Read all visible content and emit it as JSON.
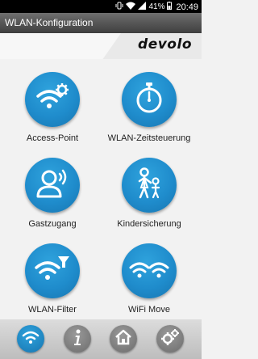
{
  "status_bar": {
    "battery": "41%",
    "time": "20:49",
    "icons": [
      "vibrate-icon",
      "wifi-signal-icon",
      "cell-signal-icon",
      "battery-icon"
    ]
  },
  "header": {
    "title": "WLAN-Konfiguration",
    "brand": "devolo"
  },
  "tiles": [
    {
      "label": "Access-Point",
      "icon": "wifi-gear-icon"
    },
    {
      "label": "WLAN-Zeitsteuerung",
      "icon": "stopwatch-icon"
    },
    {
      "label": "Gastzugang",
      "icon": "guest-user-icon"
    },
    {
      "label": "Kindersicherung",
      "icon": "parent-child-icon"
    },
    {
      "label": "WLAN-Filter",
      "icon": "wifi-filter-icon"
    },
    {
      "label": "WiFi Move",
      "icon": "wifi-move-icon"
    }
  ],
  "bottom_nav": [
    {
      "icon": "wifi-icon",
      "active": true
    },
    {
      "icon": "info-icon",
      "active": false
    },
    {
      "icon": "home-icon",
      "active": false
    },
    {
      "icon": "settings-gears-icon",
      "active": false
    }
  ],
  "colors": {
    "accent": "#1f8ccc",
    "nav_inactive": "#808080",
    "title_bar": "#4a4a4a"
  }
}
